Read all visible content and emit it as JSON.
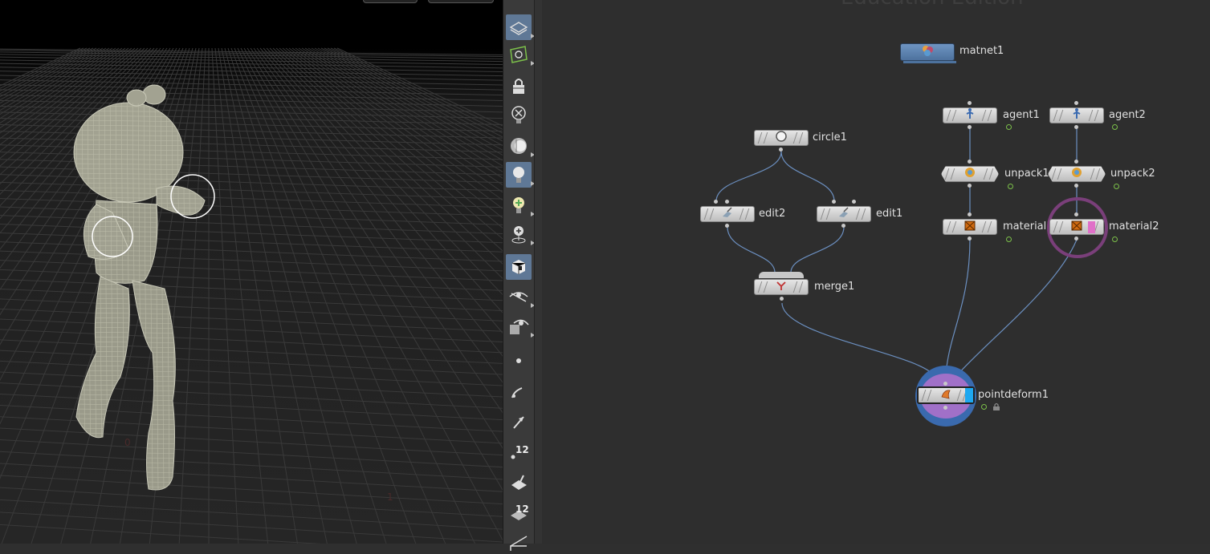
{
  "app": {
    "watermark": "Education Edition"
  },
  "toolbar": {
    "items": [
      {
        "icon": "display-options-icon",
        "active": true
      },
      {
        "icon": "camera-view-icon",
        "active": false
      },
      {
        "icon": "lock-icon",
        "active": false
      },
      {
        "icon": "close-circle-icon",
        "active": false
      },
      {
        "icon": "headlight-icon",
        "active": false
      },
      {
        "icon": "light-bulb-icon",
        "active": true
      },
      {
        "icon": "add-light-icon",
        "active": false
      },
      {
        "icon": "light-placement-icon",
        "active": false
      },
      {
        "icon": "shading-mode-icon",
        "active": true
      },
      {
        "icon": "visibility-icon",
        "active": false
      },
      {
        "icon": "ghost-visibility-icon",
        "active": false
      },
      {
        "icon": "point-display-icon",
        "active": false
      },
      {
        "icon": "normal-display-icon",
        "active": false
      },
      {
        "icon": "vector-display-icon",
        "active": false
      },
      {
        "icon": "point-numbers-icon",
        "active": false,
        "label": "12"
      },
      {
        "icon": "primitive-display-icon",
        "active": false
      },
      {
        "icon": "primitive-numbers-icon",
        "active": false,
        "label": "12"
      },
      {
        "icon": "uv-display-icon",
        "active": false
      }
    ]
  },
  "network": {
    "nodes": {
      "matnet1": {
        "label": "matnet1"
      },
      "circle1": {
        "label": "circle1"
      },
      "edit2": {
        "label": "edit2"
      },
      "edit1": {
        "label": "edit1"
      },
      "merge1": {
        "label": "merge1"
      },
      "agent1": {
        "label": "agent1"
      },
      "agent2": {
        "label": "agent2"
      },
      "unpack1": {
        "label": "unpack1"
      },
      "unpack2": {
        "label": "unpack2"
      },
      "material1": {
        "label": "material1"
      },
      "material2": {
        "label": "material2"
      },
      "pointdeform1": {
        "label": "pointdeform1"
      }
    }
  },
  "colors": {
    "wire": "#6b8fc0",
    "active_toolbar": "#5f7896",
    "display_flag": "#3a7dd6",
    "selected_ring": "#8a4f8a",
    "render_flag": "#e070c8"
  }
}
